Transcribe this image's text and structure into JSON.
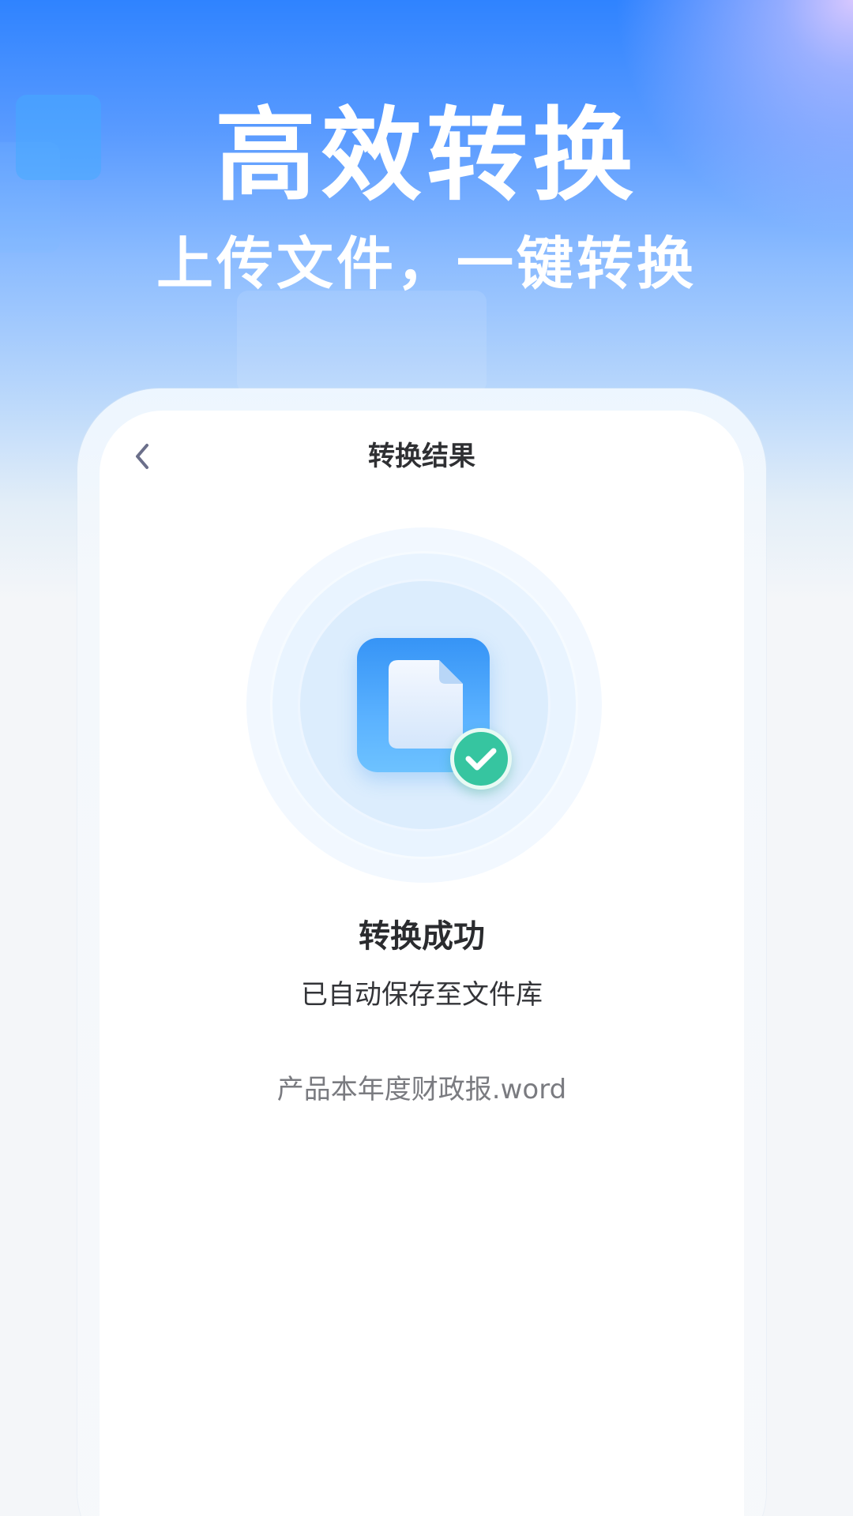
{
  "hero": {
    "title": "高效转换",
    "subtitle": "上传文件，一键转换"
  },
  "screen": {
    "nav_title": "转换结果",
    "back_icon": "chevron-left-icon",
    "result_icon": "document-icon",
    "badge_icon": "check-icon",
    "status_title": "转换成功",
    "status_desc": "已自动保存至文件库",
    "file_name": "产品本年度财政报.word"
  },
  "colors": {
    "accent_blue": "#2f83ff",
    "success_green": "#36c5a0"
  }
}
